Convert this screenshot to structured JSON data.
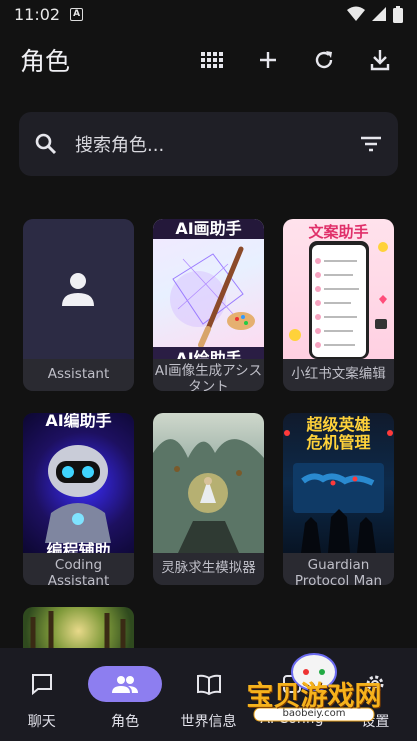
{
  "status": {
    "time": "11:02",
    "notif_glyph": "A"
  },
  "header": {
    "title": "角色",
    "actions": [
      "grid-view-icon",
      "add-icon",
      "refresh-icon",
      "download-icon"
    ]
  },
  "search": {
    "placeholder": "搜索角色..."
  },
  "cards": [
    {
      "label": "Assistant",
      "art_title": "",
      "art_caption": ""
    },
    {
      "label": "AI画像生成アシスタント",
      "art_title": "AI画助手",
      "art_caption": "AI绘助手"
    },
    {
      "label": "小红书文案编辑",
      "art_title": "文案助手",
      "art_caption": ""
    },
    {
      "label": "Coding Assistant",
      "art_title": "AI编助手",
      "art_caption": "编程辅助"
    },
    {
      "label": "灵脉求生模拟器",
      "art_title": "",
      "art_caption": ""
    },
    {
      "label": "Guardian Protocol Man",
      "art_title": "超级英雄",
      "art_caption": "危机管理"
    },
    {
      "label": "",
      "art_title": "",
      "art_caption": ""
    }
  ],
  "nav": {
    "items": [
      {
        "label": "聊天",
        "icon": "chat-icon"
      },
      {
        "label": "角色",
        "icon": "people-icon",
        "active": true
      },
      {
        "label": "世界信息",
        "icon": "book-icon"
      },
      {
        "label": "AI Config",
        "icon": "config-icon"
      },
      {
        "label": "设置",
        "icon": "gear-icon"
      }
    ]
  },
  "watermark": {
    "text": "宝贝游戏网",
    "url": "baobeiy.com"
  },
  "colors": {
    "accent": "#8d7ef0",
    "background": "#121212",
    "surface": "#1f1f26"
  }
}
